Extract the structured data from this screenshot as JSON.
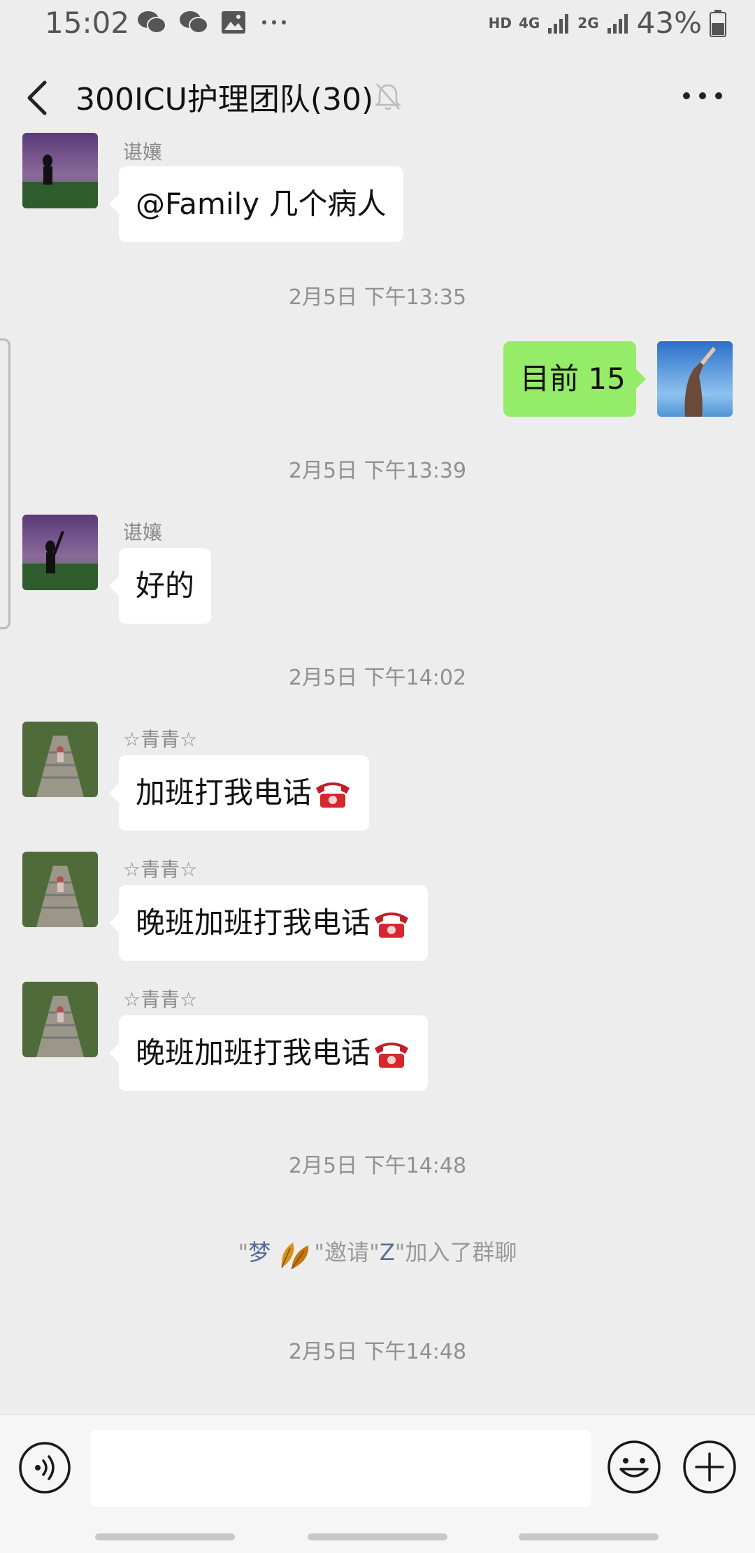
{
  "status_bar": {
    "time": "15:02",
    "hd": "HD",
    "net1": "4G",
    "net2": "2G",
    "battery": "43%",
    "icons": [
      "wechat-icon",
      "wechat-icon",
      "gallery-icon",
      "more-dots-icon"
    ]
  },
  "header": {
    "title": "300ICU护理团队(30)",
    "back_icon": "chevron-left-icon",
    "mute_icon": "bell-off-icon",
    "more_icon": "more-horizontal-icon"
  },
  "messages": [
    {
      "sender": "谌孃",
      "text": "@Family  几个病人"
    },
    {
      "timestamp": "2月5日 下午13:35"
    },
    {
      "text": "目前 15"
    },
    {
      "timestamp": "2月5日 下午13:39"
    },
    {
      "sender": "谌孃",
      "text": "好的"
    },
    {
      "timestamp": "2月5日 下午14:02"
    },
    {
      "sender": "☆青青☆",
      "text": "加班打我电话"
    },
    {
      "sender": "☆青青☆",
      "text": "晚班加班打我电话"
    },
    {
      "sender": "☆青青☆",
      "text": "晚班加班打我电话"
    },
    {
      "timestamp": "2月5日 下午14:48"
    },
    {
      "system": {
        "q1": "\"",
        "name1": "梦",
        "q2": "\"邀请\"",
        "name2": "Z",
        "q3": "\"加入了群聊"
      }
    },
    {
      "timestamp": "2月5日 下午14:48"
    }
  ],
  "colors": {
    "background": "#ededed",
    "outgoing_bubble": "#95ec69",
    "incoming_bubble": "#ffffff",
    "link_name": "#576b95"
  },
  "input_bar": {
    "voice_icon": "voice-icon",
    "emoji_icon": "emoji-icon",
    "plus_icon": "plus-circle-icon",
    "placeholder": ""
  }
}
